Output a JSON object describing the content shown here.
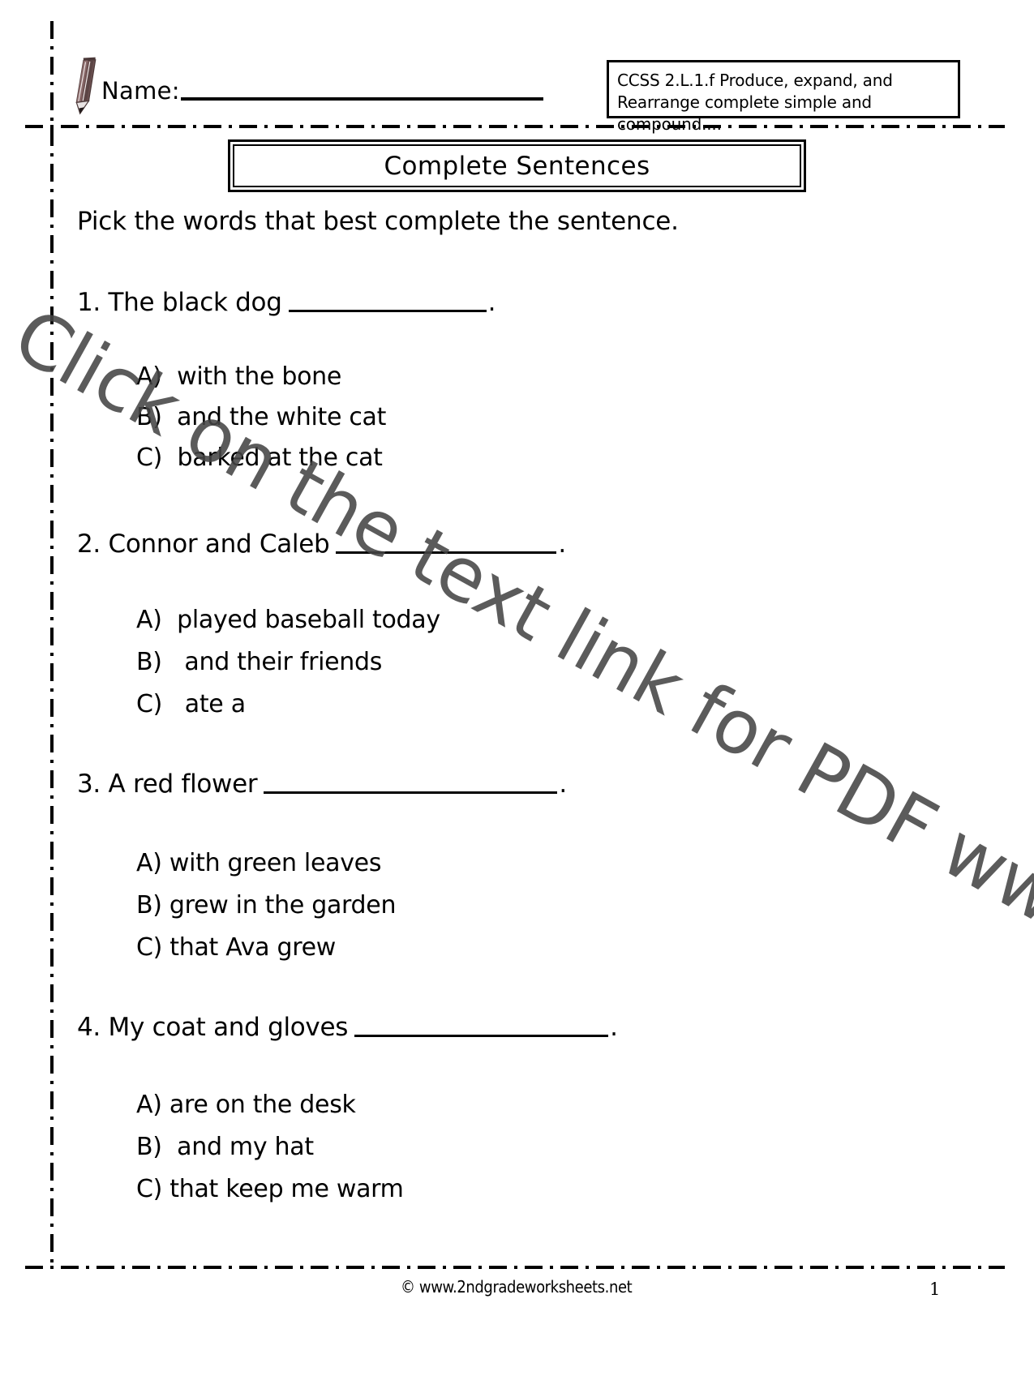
{
  "header": {
    "pencil_icon": "pencil-icon",
    "name_label": "Name:",
    "name_value": "",
    "ccss_text": "CCSS 2.L.1.f  Produce, expand, and\nRearrange complete simple and compound...."
  },
  "title": "Complete Sentences",
  "instruction": "Pick the words that best complete the sentence.",
  "questions": [
    {
      "number": "1.",
      "stem": "1. The black dog",
      "blank_width": 244,
      "period": ".",
      "options": [
        "A)  with the bone",
        "B)  and the white cat",
        "C)  barked at the cat"
      ]
    },
    {
      "number": "2.",
      "stem": "2. Connor and Caleb",
      "blank_width": 272,
      "period": ".",
      "options": [
        "A)  played baseball today",
        "B)   and their friends",
        "C)   ate a"
      ]
    },
    {
      "number": "3.",
      "stem": "3. A red flower",
      "blank_width": 362,
      "period": ".",
      "options": [
        "A) with green leaves",
        "B) grew in the garden",
        "C) that Ava grew"
      ]
    },
    {
      "number": "4.",
      "stem": "4. My coat and gloves",
      "blank_width": 313,
      "period": ".",
      "options": [
        "A) are on the desk",
        "B)  and my hat",
        "C) that keep me warm"
      ]
    }
  ],
  "watermark": "Click on the text link for PDF www.theteachersguide.com",
  "watermark_color": "#454545",
  "footer": {
    "copyright": "© www.2ndgradeworksheets.net",
    "page_number": "1"
  }
}
